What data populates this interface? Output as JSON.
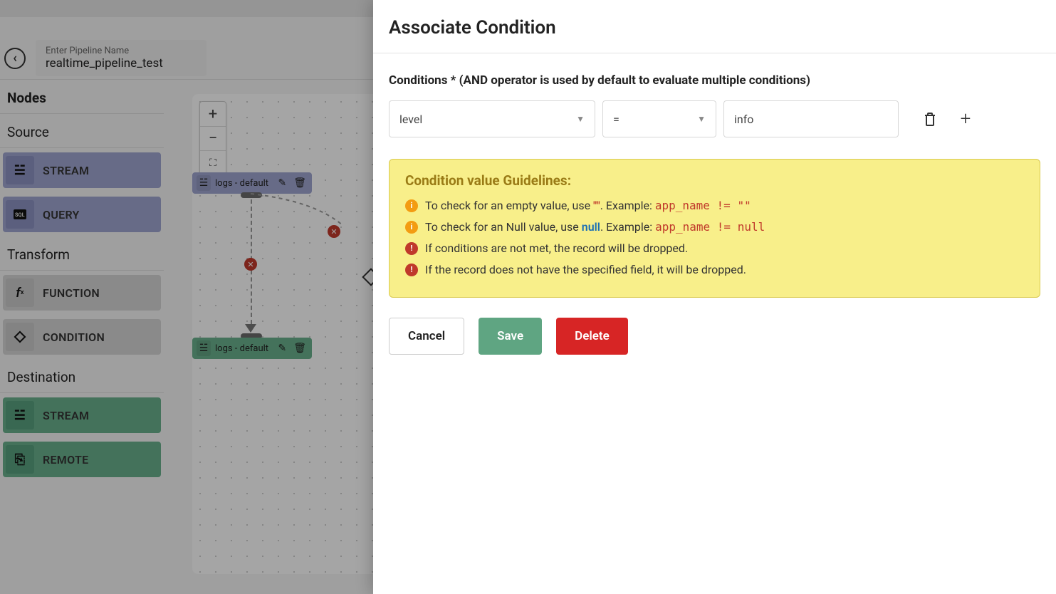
{
  "header": {
    "pipeline_placeholder": "Enter Pipeline Name",
    "pipeline_name": "realtime_pipeline_test"
  },
  "sidebar": {
    "nodes_heading": "Nodes",
    "source_heading": "Source",
    "transform_heading": "Transform",
    "destination_heading": "Destination",
    "source_items": [
      {
        "label": "STREAM"
      },
      {
        "label": "QUERY"
      }
    ],
    "transform_items": [
      {
        "label": "FUNCTION"
      },
      {
        "label": "CONDITION"
      }
    ],
    "destination_items": [
      {
        "label": "STREAM"
      },
      {
        "label": "REMOTE"
      }
    ]
  },
  "canvas": {
    "node_source_label": "logs - default",
    "node_dest_label": "logs - default"
  },
  "modal": {
    "title": "Associate Condition",
    "conditions_label": "Conditions * (AND operator is used by default to evaluate multiple conditions)",
    "condition_row": {
      "field": "level",
      "operator": "=",
      "value": "info"
    },
    "guidelines_title": "Condition value Guidelines:",
    "guides": {
      "empty_prefix": "To check for an empty value, use ",
      "empty_kw": "\"\"",
      "empty_example_label": ". Example:  ",
      "empty_example_code": "app_name != \"\"",
      "null_prefix": "To check for an Null value, use ",
      "null_kw": "null",
      "null_example_label": ". Example:  ",
      "null_example_code": "app_name != null",
      "warn1": "If conditions are not met, the record will be dropped.",
      "warn2": "If the record does not have the specified field, it will be dropped."
    },
    "buttons": {
      "cancel": "Cancel",
      "save": "Save",
      "delete": "Delete"
    }
  }
}
